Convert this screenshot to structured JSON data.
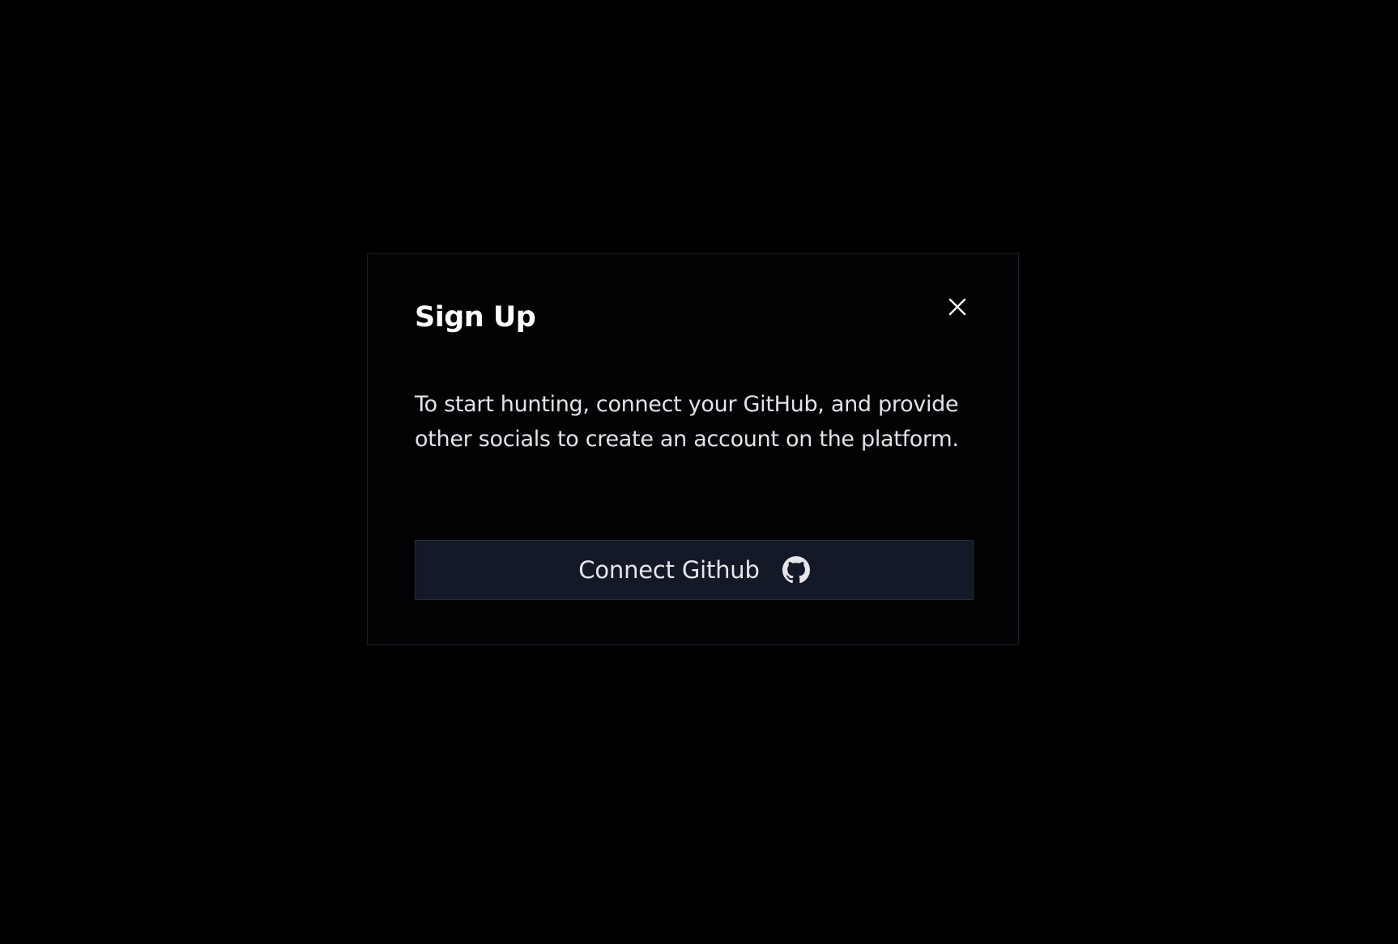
{
  "modal": {
    "title": "Sign Up",
    "description": "To start hunting, connect your GitHub, and provide other socials to create an account on the platform.",
    "close_icon": "close-icon",
    "connect_button": {
      "label": "Connect Github",
      "icon": "github-icon"
    }
  },
  "colors": {
    "background": "#000000",
    "modal_background": "#020204",
    "modal_border": "#1f1f2a",
    "button_background": "#131927",
    "text_primary": "#ffffff",
    "text_secondary": "#e3e3e8"
  }
}
